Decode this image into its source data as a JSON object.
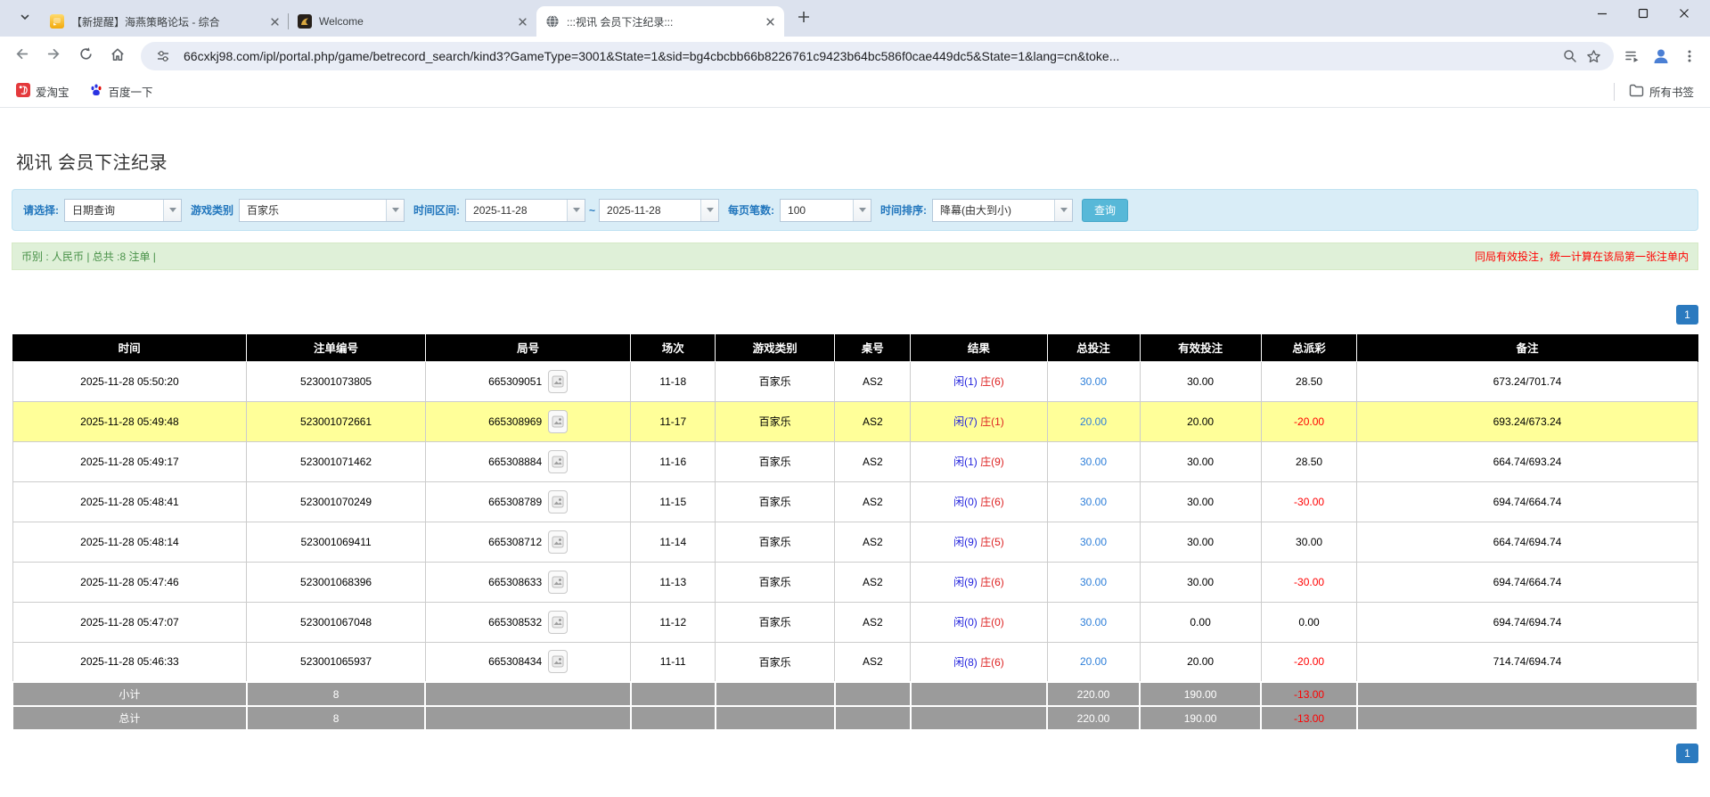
{
  "colors": {
    "accent_blue": "#2b7abf",
    "highlight_row": "#ffff99",
    "filter_bg": "#d9edf7",
    "summary_bg": "#dff0d8",
    "header_bg": "#000000",
    "footer_bg": "#9b9b9b",
    "bet_link_blue": "#2e7fd9",
    "negative_red": "#ff0000"
  },
  "browser": {
    "tabs": [
      {
        "title": "【新提醒】海燕策略论坛 - 综合",
        "icon": "chat-favicon",
        "active": false
      },
      {
        "title": "Welcome",
        "icon": "horse-favicon",
        "active": false
      },
      {
        "title": ":::视讯 会员下注纪录:::",
        "icon": "globe-favicon",
        "active": true
      }
    ],
    "url": "66cxkj98.com/ipl/portal.php/game/betrecord_search/kind3?GameType=3001&State=1&sid=bg4cbcbb66b8226761c9423b64bc586f0cae449dc5&State=1&lang=cn&toke...",
    "bookmarks": [
      {
        "label": "爱淘宝",
        "icon": "taobao-icon"
      },
      {
        "label": "百度一下",
        "icon": "baidu-icon"
      }
    ],
    "all_bookmarks_label": "所有书签"
  },
  "page": {
    "title": "视讯 会员下注纪录",
    "filters": {
      "select_label": "请选择:",
      "select_value": "日期查询",
      "game_type_label": "游戏类别",
      "game_type_value": "百家乐",
      "date_range_label": "时间区间:",
      "date_from": "2025-11-28",
      "range_separator": "~",
      "date_to": "2025-11-28",
      "page_size_label": "每页笔数:",
      "page_size_value": "100",
      "sort_label": "时间排序:",
      "sort_value": "降幕(由大到小)",
      "search_button": "查询"
    },
    "summary_bar": {
      "left_text": "币别 : 人民币 | 总共 :8 注单 |",
      "right_text": "同局有效投注，统一计算在该局第一张注单内"
    },
    "pagination": "1",
    "table": {
      "headers": [
        "时间",
        "注单编号",
        "局号",
        "场次",
        "游戏类别",
        "桌号",
        "结果",
        "总投注",
        "有效投注",
        "总派彩",
        "备注"
      ],
      "col_widths": [
        "13.9%",
        "10.6%",
        "12.2%",
        "5.0%",
        "7.1%",
        "4.5%",
        "8.1%",
        "5.5%",
        "7.2%",
        "5.7%",
        "20.2%"
      ],
      "rows": [
        {
          "time": "2025-11-28 05:50:20",
          "bet_id": "523001073805",
          "round_id": "665309051",
          "session": "11-18",
          "game": "百家乐",
          "table": "AS2",
          "player": "闲(1)",
          "banker": "庄(6)",
          "total_bet": "30.00",
          "valid_bet": "30.00",
          "payout": "28.50",
          "remark": "673.24/701.74",
          "highlight": false
        },
        {
          "time": "2025-11-28 05:49:48",
          "bet_id": "523001072661",
          "round_id": "665308969",
          "session": "11-17",
          "game": "百家乐",
          "table": "AS2",
          "player": "闲(7)",
          "banker": "庄(1)",
          "total_bet": "20.00",
          "valid_bet": "20.00",
          "payout": "-20.00",
          "remark": "693.24/673.24",
          "highlight": true
        },
        {
          "time": "2025-11-28 05:49:17",
          "bet_id": "523001071462",
          "round_id": "665308884",
          "session": "11-16",
          "game": "百家乐",
          "table": "AS2",
          "player": "闲(1)",
          "banker": "庄(9)",
          "total_bet": "30.00",
          "valid_bet": "30.00",
          "payout": "28.50",
          "remark": "664.74/693.24",
          "highlight": false
        },
        {
          "time": "2025-11-28 05:48:41",
          "bet_id": "523001070249",
          "round_id": "665308789",
          "session": "11-15",
          "game": "百家乐",
          "table": "AS2",
          "player": "闲(0)",
          "banker": "庄(6)",
          "total_bet": "30.00",
          "valid_bet": "30.00",
          "payout": "-30.00",
          "remark": "694.74/664.74",
          "highlight": false
        },
        {
          "time": "2025-11-28 05:48:14",
          "bet_id": "523001069411",
          "round_id": "665308712",
          "session": "11-14",
          "game": "百家乐",
          "table": "AS2",
          "player": "闲(9)",
          "banker": "庄(5)",
          "total_bet": "30.00",
          "valid_bet": "30.00",
          "payout": "30.00",
          "remark": "664.74/694.74",
          "highlight": false
        },
        {
          "time": "2025-11-28 05:47:46",
          "bet_id": "523001068396",
          "round_id": "665308633",
          "session": "11-13",
          "game": "百家乐",
          "table": "AS2",
          "player": "闲(9)",
          "banker": "庄(6)",
          "total_bet": "30.00",
          "valid_bet": "30.00",
          "payout": "-30.00",
          "remark": "694.74/664.74",
          "highlight": false
        },
        {
          "time": "2025-11-28 05:47:07",
          "bet_id": "523001067048",
          "round_id": "665308532",
          "session": "11-12",
          "game": "百家乐",
          "table": "AS2",
          "player": "闲(0)",
          "banker": "庄(0)",
          "total_bet": "30.00",
          "valid_bet": "0.00",
          "payout": "0.00",
          "remark": "694.74/694.74",
          "highlight": false
        },
        {
          "time": "2025-11-28 05:46:33",
          "bet_id": "523001065937",
          "round_id": "665308434",
          "session": "11-11",
          "game": "百家乐",
          "table": "AS2",
          "player": "闲(8)",
          "banker": "庄(6)",
          "total_bet": "20.00",
          "valid_bet": "20.00",
          "payout": "-20.00",
          "remark": "714.74/694.74",
          "highlight": false
        }
      ],
      "subtotal": {
        "label": "小计",
        "count": "8",
        "total_bet": "220.00",
        "valid_bet": "190.00",
        "payout": "-13.00"
      },
      "total": {
        "label": "总计",
        "count": "8",
        "total_bet": "220.00",
        "valid_bet": "190.00",
        "payout": "-13.00"
      }
    }
  }
}
